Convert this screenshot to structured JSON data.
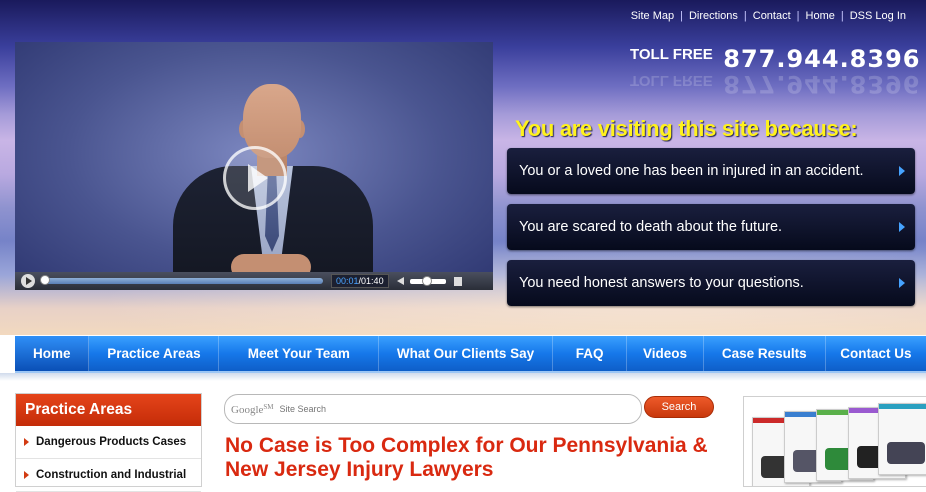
{
  "top_links": [
    "Site Map",
    "Directions",
    "Contact",
    "Home",
    "DSS Log In"
  ],
  "phone": {
    "label": "TOLL FREE",
    "number": "877.944.8396"
  },
  "hero": {
    "heading": "You are visiting this site because:",
    "reasons": [
      "You or a loved one has been in injured in an accident.",
      "You are scared to death about the future.",
      "You need honest answers to your questions."
    ]
  },
  "video": {
    "current_time": "00:01",
    "separator": "/",
    "duration": "01:40",
    "progress": 0.0
  },
  "nav": [
    "Home",
    "Practice Areas",
    "Meet Your Team",
    "What Our Clients Say",
    "FAQ",
    "Videos",
    "Case Results",
    "Contact Us"
  ],
  "practice_areas": {
    "title": "Practice Areas",
    "items": [
      "Dangerous Products Cases",
      "Construction and Industrial"
    ]
  },
  "search": {
    "brand": "Google",
    "brand_mark": "SM",
    "placeholder": "Site Search",
    "button": "Search"
  },
  "headline": "No Case is Too Complex for Our Pennsylvania & New Jersey Injury Lawyers",
  "colors": {
    "nav_blue": "#1678ea",
    "accent_orange": "#d92910",
    "hero_yellow": "#fff21c"
  }
}
